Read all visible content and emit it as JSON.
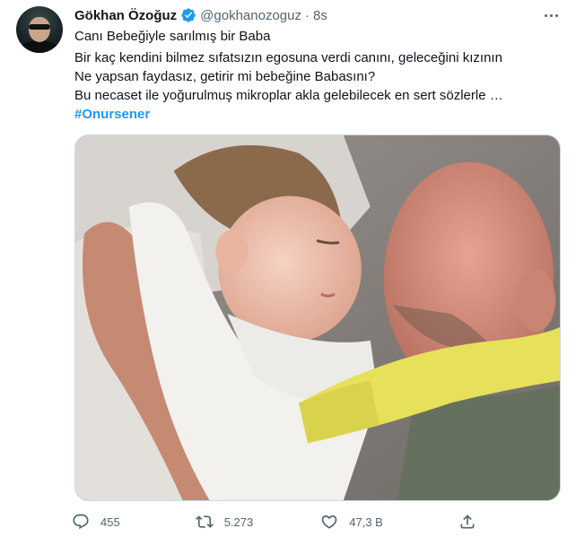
{
  "author": {
    "name": "Gökhan Özoğuz",
    "handle": "@gokhanozoguz",
    "separator": "·",
    "time": "8s"
  },
  "tweet": {
    "lines": [
      "Canı Bebeğiyle sarılmış bir Baba",
      "Bir kaç kendini bilmez sıfatsızın egosuna verdi canını, geleceğini kızının",
      "Ne yapsan faydasız, getirir mi bebeğine Babasını?",
      "Bu necaset ile yoğurulmuş mikroplar  akla gelebilecek en sert sözlerle …"
    ],
    "hashtag": "#Onursener"
  },
  "actions": {
    "replies": "455",
    "retweets": "5.273",
    "likes": "47,3 B"
  },
  "colors": {
    "accent": "#1d9bf0",
    "secondary_text": "#536471",
    "primary_text": "#0f1419"
  },
  "icons": {
    "verified": "verified-badge-icon",
    "more": "more-options-icon",
    "reply": "reply-icon",
    "retweet": "retweet-icon",
    "like": "like-icon",
    "share": "share-icon"
  }
}
